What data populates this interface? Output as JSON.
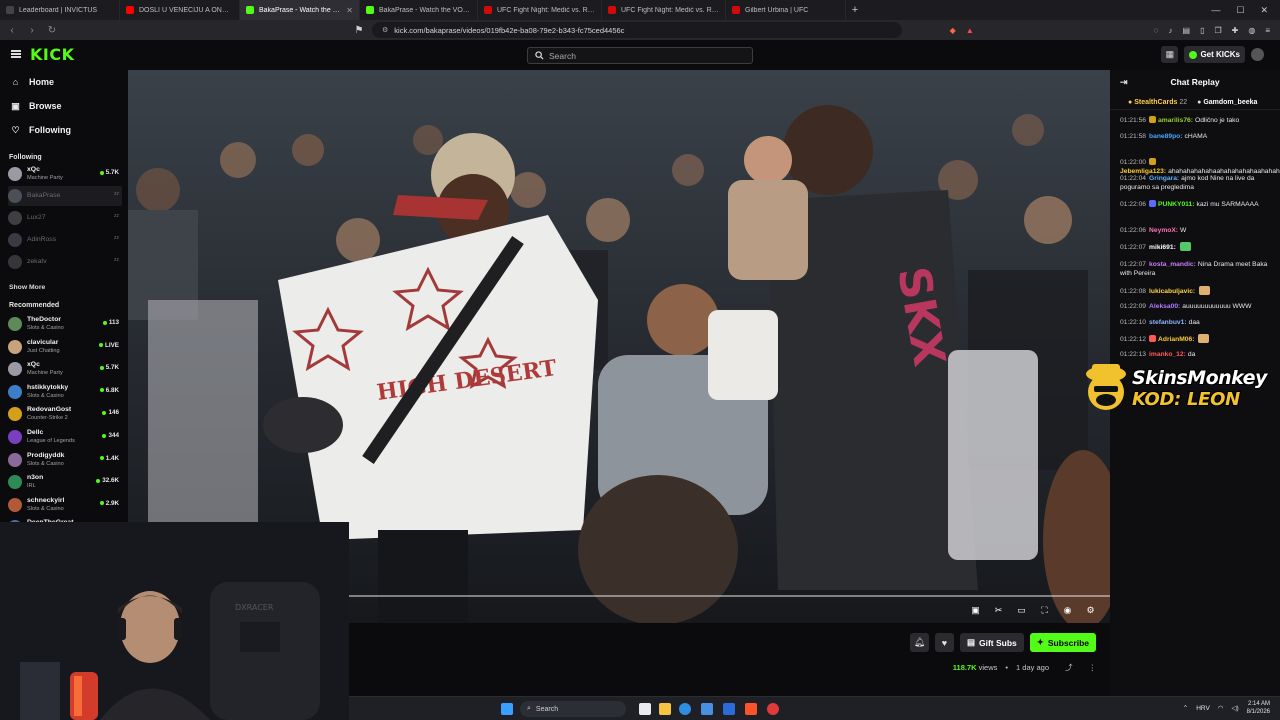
{
  "browser": {
    "tabs": [
      {
        "title": "Leaderboard | INVICTUS",
        "color": "#444444",
        "active": false
      },
      {
        "title": "DOSLI U VENECIJU A ONDA.. *ODLE...",
        "color": "#ff0000",
        "active": false
      },
      {
        "title": "BakaPrase - Watch the VOD o...",
        "color": "#53fc18",
        "active": true
      },
      {
        "title": "BakaPrase - Watch the VOD on Kick",
        "color": "#53fc18",
        "active": false
      },
      {
        "title": "UFC Fight Night: Medić vs. Rodrigue...",
        "color": "#d20a0a",
        "active": false
      },
      {
        "title": "UFC Fight Night: Medić vs. Rodrigue...",
        "color": "#d20a0a",
        "active": false
      },
      {
        "title": "Gilbert Urbina | UFC",
        "color": "#d20a0a",
        "active": false
      }
    ],
    "url": "kick.com/bakaprase/videos/019fb42e-ba08-79e2-b343-fc75ced4456c"
  },
  "header": {
    "logo": "KICK",
    "search_placeholder": "Search",
    "get_kicks_label": "Get KICKs"
  },
  "sidebar": {
    "nav": [
      {
        "label": "Home",
        "icon": "home-icon"
      },
      {
        "label": "Browse",
        "icon": "browse-icon"
      },
      {
        "label": "Following",
        "icon": "heart-icon"
      }
    ],
    "following_title": "Following",
    "following": [
      {
        "name": "xQc",
        "category": "Machine Party",
        "viewers": "5.7K",
        "live": true,
        "color": "#9a9aa5"
      },
      {
        "name": "BakaPrase",
        "category": "",
        "viewers": "",
        "live": false,
        "color": "#8a8f98"
      },
      {
        "name": "Lux27",
        "category": "",
        "viewers": "",
        "live": false,
        "color": "#7c7c85"
      },
      {
        "name": "AdinRoss",
        "category": "",
        "viewers": "",
        "live": false,
        "color": "#6f7580"
      },
      {
        "name": "zekatv",
        "category": "",
        "viewers": "",
        "live": false,
        "color": "#6b6b72"
      }
    ],
    "show_more": "Show More",
    "recommended_title": "Recommended",
    "recommended": [
      {
        "name": "TheDoctor",
        "category": "Slots & Casino",
        "viewers": "113",
        "color": "#5d8a5a"
      },
      {
        "name": "clavicular",
        "category": "Just Chatting",
        "viewers": "LIVE",
        "color": "#c8a27a"
      },
      {
        "name": "xQc",
        "category": "Machine Party",
        "viewers": "5.7K",
        "color": "#9a9aa5"
      },
      {
        "name": "hstikkytokky",
        "category": "Slots & Casino",
        "viewers": "6.8K",
        "color": "#3a7fc8"
      },
      {
        "name": "RedovanGost",
        "category": "Counter-Strike 2",
        "viewers": "146",
        "color": "#d4a017"
      },
      {
        "name": "Dellc",
        "category": "League of Legends",
        "viewers": "344",
        "color": "#7a3fbf"
      },
      {
        "name": "Prodigyddk",
        "category": "Slots & Casino",
        "viewers": "1.4K",
        "color": "#8a6a9a"
      },
      {
        "name": "n3on",
        "category": "IRL",
        "viewers": "32.6K",
        "color": "#2e8b57"
      },
      {
        "name": "schneckyirl",
        "category": "Slots & Casino",
        "viewers": "2.9K",
        "color": "#b05a3a"
      },
      {
        "name": "DeenTheGreat",
        "category": "",
        "viewers": "13.9K",
        "color": "#4a6aa8"
      }
    ]
  },
  "video": {
    "progress": 0.0
  },
  "below_video": {
    "gift_label": "Gift Subs",
    "subscribe_label": "Subscribe",
    "views": "118.7K",
    "views_suffix": "views",
    "age": "1 day ago"
  },
  "chat": {
    "title": "Chat Replay",
    "pinned": [
      {
        "name": "StealthCards",
        "count": "22"
      },
      {
        "name": "Gamdom_beeka",
        "count": ""
      }
    ],
    "messages": [
      {
        "ts": "01:21:56",
        "user": "amarilis76:",
        "color": "#9acd32",
        "text": "Odlično je tako",
        "badge": "#d4a017"
      },
      {
        "ts": "01:21:58",
        "user": "bane89po:",
        "color": "#4aa3ff",
        "text": "cHAMA",
        "badge": ""
      },
      {
        "ts": "01:22:00",
        "user": "Jebemliga123:",
        "color": "#ffcc33",
        "text": "ahahahahahahaahahahahahaahahahaah",
        "badge": "#d4a017"
      },
      {
        "ts": "01:22:04",
        "user": "Gringara:",
        "color": "#5bb0ff",
        "text": "ajmo kod Nine na live da poguramo sa pregledima",
        "badge": ""
      },
      {
        "ts": "01:22:06",
        "user": "PUNKY011:",
        "color": "#53fc18",
        "text": "kazi mu SARMAAAA",
        "badge": "#5b6bff"
      },
      {
        "ts": "01:22:06",
        "user": "NeymoX:",
        "color": "#ff6fb5",
        "text": "W",
        "badge": ""
      },
      {
        "ts": "01:22:07",
        "user": "miki691:",
        "color": "#ffffff",
        "text": "",
        "badge": ""
      },
      {
        "ts": "01:22:07",
        "user": "kosta_mandic:",
        "color": "#c77dff",
        "text": "Nina Drama meet Baka with Pereira",
        "badge": ""
      },
      {
        "ts": "01:22:08",
        "user": "lukicabuljavic:",
        "color": "#ffd24a",
        "text": "",
        "badge": ""
      },
      {
        "ts": "01:22:09",
        "user": "Aleksa00:",
        "color": "#b07cff",
        "text": "auuuuuuuuuuuu WWW",
        "badge": ""
      },
      {
        "ts": "01:22:10",
        "user": "stefanbuv1:",
        "color": "#8fb2ff",
        "text": "daa",
        "badge": ""
      },
      {
        "ts": "01:22:12",
        "user": "AdrianM06:",
        "color": "#ffcc33",
        "text": "",
        "badge": "#ff5a5a"
      },
      {
        "ts": "01:22:13",
        "user": "imanko_12:",
        "color": "#ff5a5a",
        "text": "da",
        "badge": ""
      }
    ]
  },
  "overlay": {
    "line1": "SkinsMonkey",
    "line2": "KOD: LEON"
  },
  "taskbar": {
    "search_placeholder": "Search",
    "lang": "HRV",
    "time": "2:14 AM",
    "date": "8/1/2026"
  }
}
